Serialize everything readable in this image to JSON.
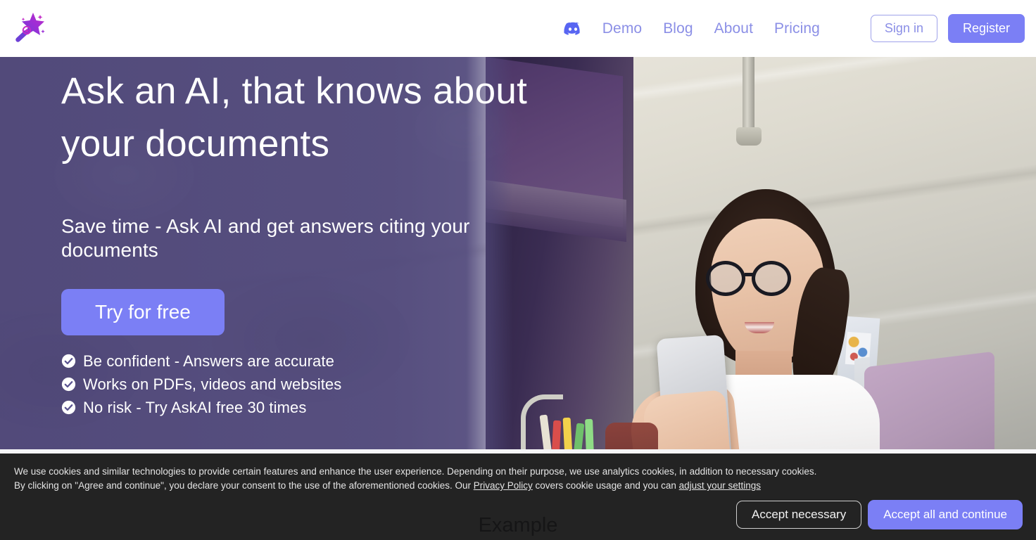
{
  "brand": {
    "logo_icon": "magic-wand-icon",
    "accent_color": "#7b7ff5",
    "nav_link_color": "#8b8fe6",
    "hero_overlay_color": "#524a7c"
  },
  "header": {
    "discord_icon": "discord-icon",
    "nav_links": [
      {
        "label": "Demo"
      },
      {
        "label": "Blog"
      },
      {
        "label": "About"
      },
      {
        "label": "Pricing"
      }
    ],
    "sign_in_label": "Sign in",
    "register_label": "Register"
  },
  "hero": {
    "heading": "Ask an AI, that knows about your documents",
    "subheading": "Save time - Ask AI and get answers citing your documents",
    "cta_label": "Try for free",
    "bullets": [
      {
        "icon": "check-circle-icon",
        "text": "Be confident - Answers are accurate"
      },
      {
        "icon": "check-circle-icon",
        "text": "Works on PDFs, videos and websites"
      },
      {
        "icon": "check-circle-icon",
        "text": "No risk - Try AskAI free 30 times"
      }
    ],
    "image_alt": "Woman with glasses holding a smartphone at a desk"
  },
  "below_fold": {
    "section_title": "Example"
  },
  "cookie_banner": {
    "line1": "We use cookies and similar technologies to provide certain features and enhance the user experience. Depending on their purpose, we use analytics cookies, in addition to necessary cookies.",
    "line2_part1": "By clicking on \"Agree and continue\", you declare your consent to the use of the aforementioned cookies. Our ",
    "privacy_link": "Privacy Policy",
    "line2_part2": " covers cookie usage and you can ",
    "settings_link": "adjust your settings",
    "accept_necessary_label": "Accept necessary",
    "accept_all_label": "Accept all and continue"
  }
}
